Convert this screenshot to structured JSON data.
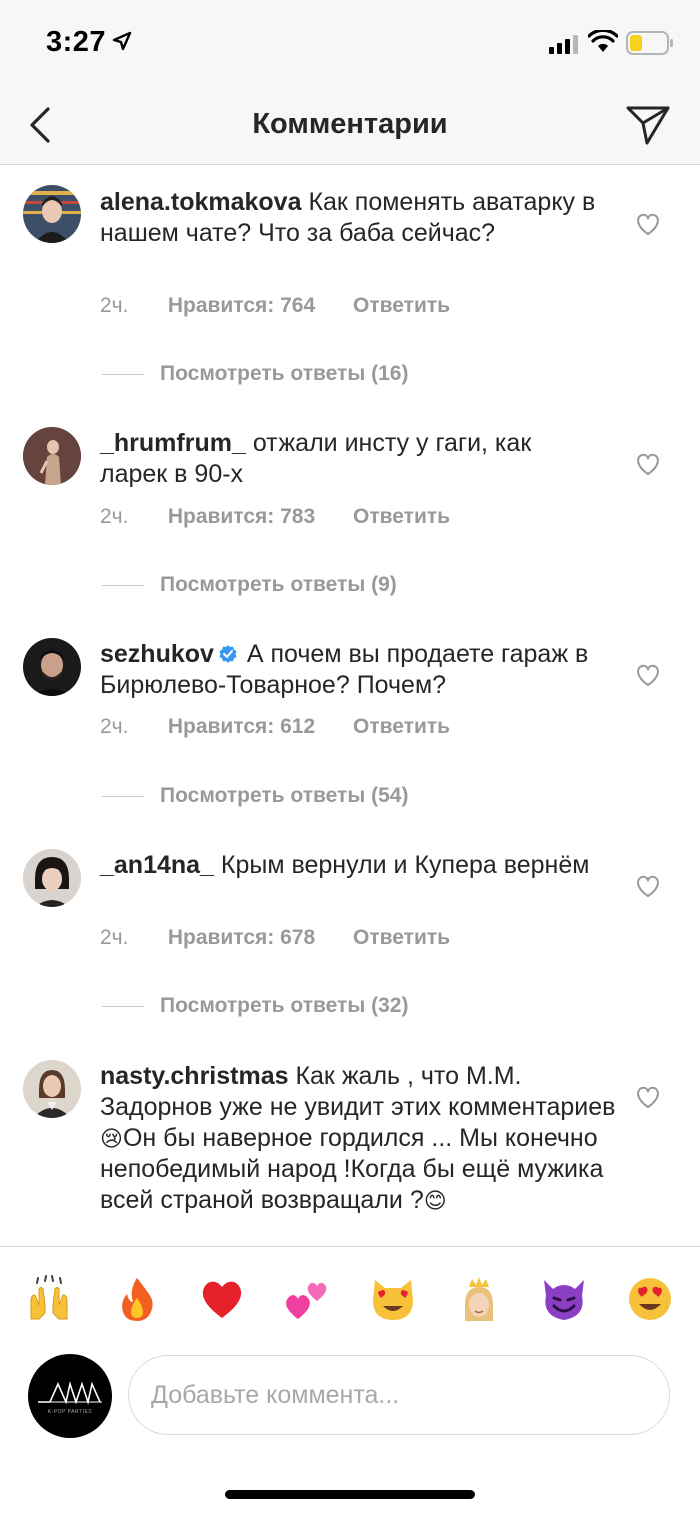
{
  "status_bar": {
    "time": "3:27",
    "icons": [
      "location-arrow-icon",
      "signal-icon",
      "wifi-icon",
      "battery-icon"
    ],
    "battery_color": "#f5d21c"
  },
  "header": {
    "title": "Комментарии",
    "back_icon": "chevron-left-icon",
    "send_icon": "paper-plane-icon"
  },
  "comments": [
    {
      "username": "alena.tokmakova",
      "text": "Как поменять аватарку в нашем чате? Что за баба сейчас?",
      "time": "2ч.",
      "likes": "Нравится: 764",
      "reply": "Ответить",
      "view_replies": "Посмотреть ответы (16)",
      "verified": false
    },
    {
      "username": "_hrumfrum_",
      "text": "отжали инсту у гаги, как ларек в 90-х",
      "time": "2ч.",
      "likes": "Нравится: 783",
      "reply": "Ответить",
      "view_replies": "Посмотреть ответы (9)",
      "verified": false
    },
    {
      "username": "sezhukov",
      "text": "А почем вы продаете гараж в Бирюлево-Товарное? Почем?",
      "time": "2ч.",
      "likes": "Нравится: 612",
      "reply": "Ответить",
      "view_replies": "Посмотреть ответы (54)",
      "verified": true
    },
    {
      "username": "_an14na_",
      "text": "Крым вернули и Купера вернём",
      "time": "2ч.",
      "likes": "Нравится: 678",
      "reply": "Ответить",
      "view_replies": "Посмотреть ответы (32)",
      "verified": false
    },
    {
      "username": "nasty.christmas",
      "text_before_emoji": "Как жаль , что М.М. Задорнов уже не увидит этих комментариев ",
      "emoji_1": "😢",
      "text_after_emoji": "Он бы наверное гордился ... Мы конечно непобедимый народ !Когда бы ещё мужика всей страной возвращали ?",
      "emoji_2": "😊",
      "verified": false
    }
  ],
  "emoji_bar": [
    "🙌",
    "🔥",
    "❤️",
    "💕",
    "😻",
    "👸",
    "😈",
    "😍"
  ],
  "composer": {
    "placeholder": "Добавьте коммента...",
    "avatar_caption": "K-POP PARTIES"
  }
}
